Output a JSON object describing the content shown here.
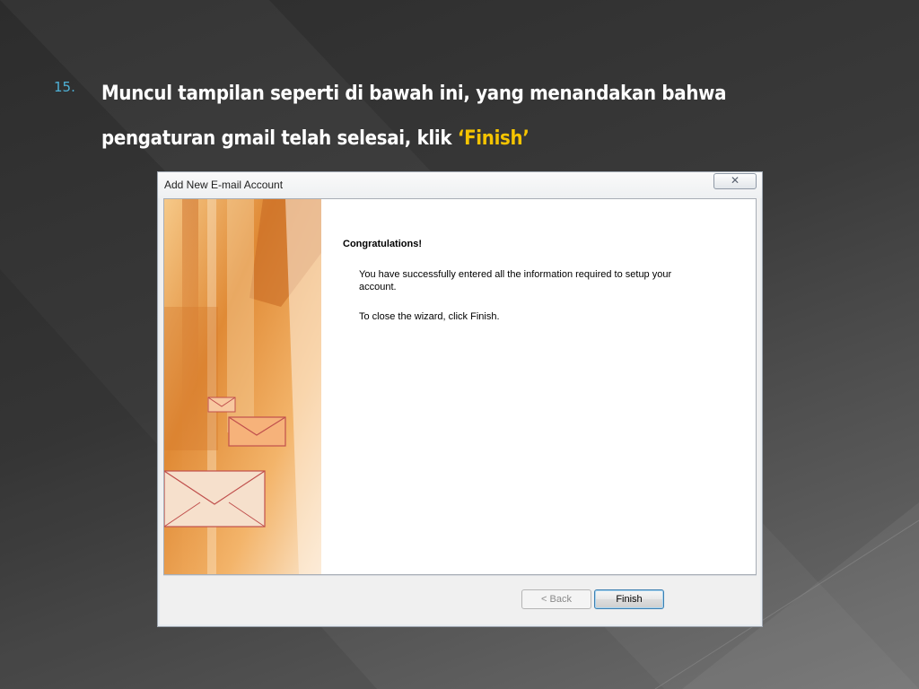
{
  "step": {
    "number": "15.",
    "line1": "Muncul tampilan seperti di bawah ini, yang menandakan bahwa",
    "line2": "pengaturan gmail telah selesai, klik ",
    "highlight": "‘Finish’"
  },
  "dialog": {
    "title": "Add New E-mail Account",
    "close_glyph": "✕",
    "heading": "Congratulations!",
    "body": "You have successfully entered all the information required to setup your account.",
    "close_instruction": "To close the wizard, click Finish.",
    "back_label": "< Back",
    "finish_label": "Finish"
  },
  "colors": {
    "step_number": "#4fb1d6",
    "highlight": "#f5c400",
    "art_orange": "#e89a3c"
  },
  "icons": [
    "close-icon",
    "envelope-icon"
  ]
}
